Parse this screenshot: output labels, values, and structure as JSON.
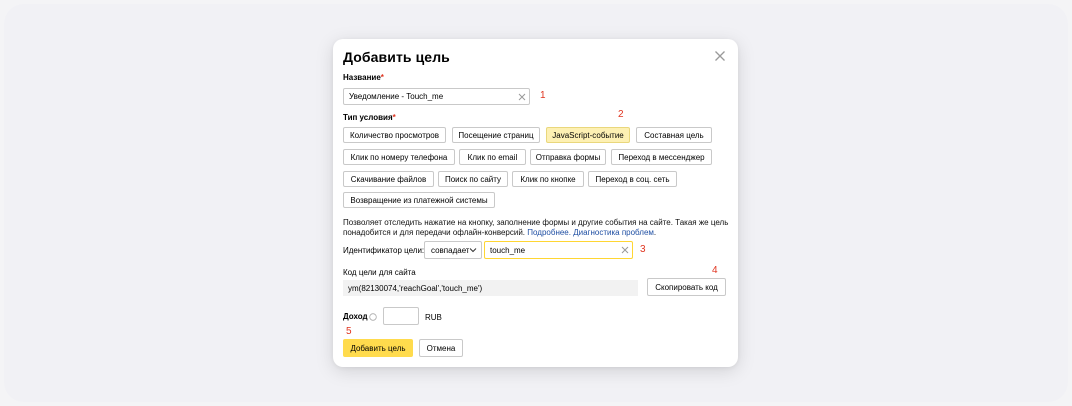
{
  "modal": {
    "title": "Добавить цель",
    "name_label": "Название",
    "required_mark": "*",
    "name_value": "Уведомление - Touch_me",
    "condition_label": "Тип условия",
    "condition_types": [
      "Количество просмотров",
      "Посещение страниц",
      "JavaScript-событие",
      "Составная цель",
      "Клик по номеру телефона",
      "Клик по email",
      "Отправка формы",
      "Переход в мессенджер",
      "Скачивание файлов",
      "Поиск по сайту",
      "Клик по кнопке",
      "Переход в соц. сеть",
      "Возвращение из платежной системы"
    ],
    "selected_condition": "JavaScript-событие",
    "description_line1": "Позволяет отследить нажатие на кнопку, заполнение формы и другие события на сайте. Такая же цель",
    "description_line2": "понадобится и для передачи офлайн-конверсий.",
    "more_link": "Подробнее.",
    "diag_link": "Диагностика проблем",
    "period": ".",
    "goal_id_label": "Идентификатор цели:",
    "match_select": "совпадает",
    "goal_id_value": "touch_me",
    "code_label": "Код цели для сайта",
    "code_value": "ym(82130074,'reachGoal','touch_me')",
    "copy_button": "Скопировать код",
    "income_label": "Доход",
    "income_value": "",
    "currency": "RUB",
    "add_button": "Добавить цель",
    "cancel_button": "Отмена"
  },
  "annotations": [
    "1",
    "2",
    "3",
    "4",
    "5"
  ],
  "colors": {
    "accent_yellow": "#ffdb4d",
    "selected_chip": "#fdf0b3",
    "annotation_red": "#e0341f",
    "link_blue": "#1f4fa3"
  }
}
